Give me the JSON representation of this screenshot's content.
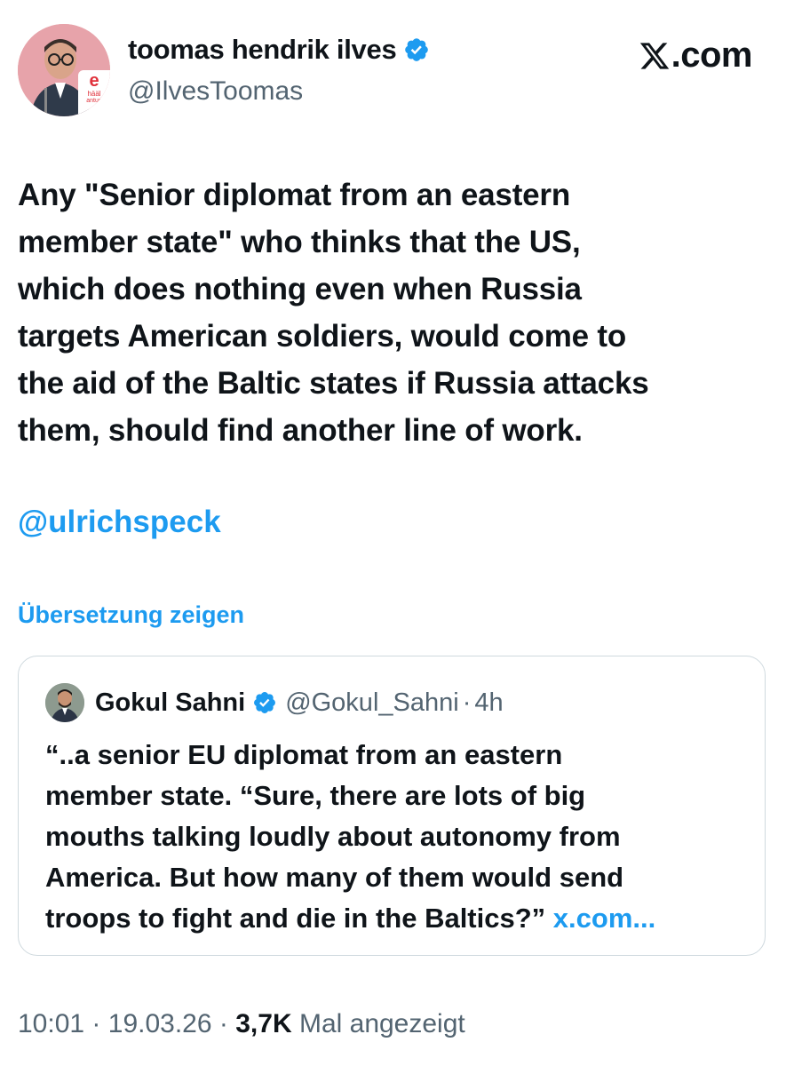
{
  "author": {
    "name": "toomas hendrik ilves",
    "handle": "@IlvesToomas",
    "avatar_badge": {
      "letter": "e",
      "text_line1": "hääl",
      "text_line2": "antud"
    }
  },
  "brand": {
    "label": ".com"
  },
  "tweet": {
    "lines": [
      "Any \"Senior diplomat from an eastern",
      "member state\" who thinks that the US,",
      "which does nothing even when Russia",
      "targets American soldiers, would come to",
      "the aid of the Baltic states if Russia attacks",
      "them, should find another line of work."
    ],
    "mention": "@ulrichspeck",
    "translate_label": "Übersetzung zeigen"
  },
  "quote": {
    "name": "Gokul Sahni",
    "handle": "@Gokul_Sahni",
    "separator": "·",
    "time": "4h",
    "lines": [
      "“..a senior EU diplomat from an eastern",
      "member state. “Sure, there are lots of big",
      "mouths talking loudly about autonomy from",
      "America. But how many of them would send",
      "troops to fight and die in the Baltics?”"
    ],
    "link_text": "x.com..."
  },
  "meta": {
    "time": "10:01",
    "sep1": "·",
    "date": "19.03.26",
    "sep2": "·",
    "views_count": "3,7K",
    "views_label": "Mal angezeigt"
  },
  "colors": {
    "text_primary": "#0f1419",
    "text_secondary": "#536471",
    "link_blue": "#1d9bf0",
    "verified_blue": "#1d9bf0",
    "card_border": "#cfd9de",
    "background": "#ffffff"
  },
  "icons": {
    "verified": "verified-badge-icon",
    "x_logo": "x-logo-icon"
  }
}
